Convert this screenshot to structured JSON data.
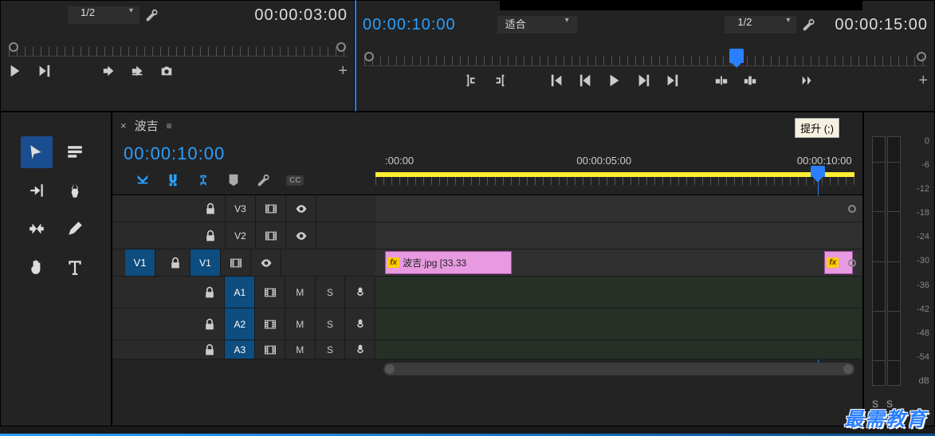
{
  "source_monitor": {
    "zoom": "1/2",
    "timecode_right": "00:00:03:00"
  },
  "program_monitor": {
    "timecode_left": "00:00:10:00",
    "fit_label": "适合",
    "zoom": "1/2",
    "timecode_right": "00:00:15:00",
    "playhead_fraction": 0.65
  },
  "tooltip": {
    "text": "提升 (;)"
  },
  "sequence": {
    "name": "波吉",
    "timecode": "00:00:10:00",
    "ruler_labels": [
      {
        "text": ":00:00",
        "pos": 0.02
      },
      {
        "text": "00:00:05:00",
        "pos": 0.42
      },
      {
        "text": "00:00:10:00",
        "pos": 0.9
      }
    ],
    "playhead_fraction": 0.908
  },
  "tracks": {
    "video": [
      {
        "label": "V3",
        "source": null,
        "locked": false
      },
      {
        "label": "V2",
        "source": null,
        "locked": false
      },
      {
        "label": "V1",
        "source": "V1",
        "locked": false
      }
    ],
    "audio": [
      {
        "label": "A1",
        "source": null
      },
      {
        "label": "A2",
        "source": null
      },
      {
        "label": "A3",
        "source": null
      }
    ]
  },
  "clips": [
    {
      "track": "V1",
      "name": "波吉.jpg [33.33",
      "start": 0.02,
      "end": 0.28
    },
    {
      "track": "V1",
      "name": "",
      "start": 0.922,
      "end": 0.98
    }
  ],
  "meter_scale": [
    "0",
    "-6",
    "-12",
    "-18",
    "-24",
    "-30",
    "-36",
    "-42",
    "-48",
    "-54",
    "dB"
  ],
  "meter_solo": [
    "S",
    "S"
  ],
  "watermark": "最需教育"
}
